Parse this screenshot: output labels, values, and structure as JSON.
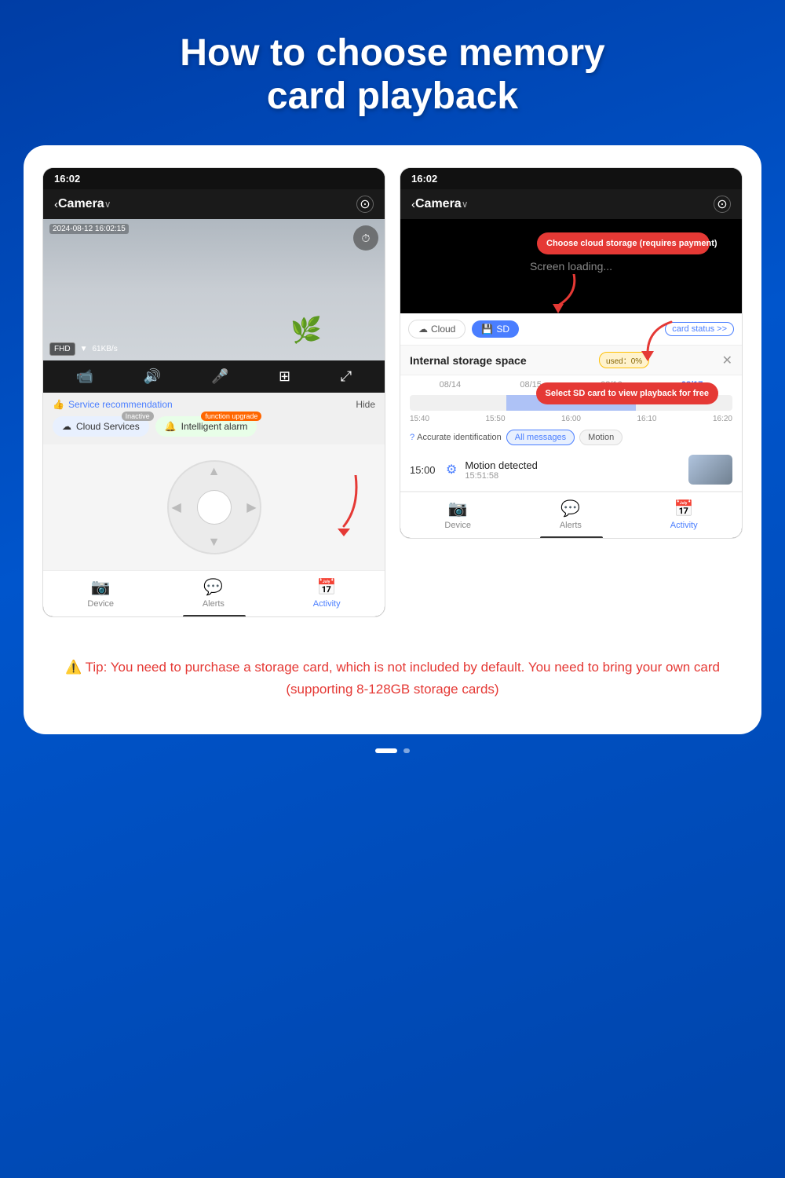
{
  "page": {
    "title_line1": "How to choose memory",
    "title_line2": "card playback",
    "background_color": "#0044bb"
  },
  "left_phone": {
    "status_bar": "16:02",
    "nav_title": "Camera",
    "timestamp": "2024-08-12 16:02:15",
    "quality": "FHD",
    "speed": "61KB/s",
    "rec_label": "Service recommendation",
    "hide_label": "Hide",
    "cloud_btn": "Cloud Services",
    "cloud_badge": "Inactive",
    "alarm_btn": "Intelligent alarm",
    "alarm_badge": "function upgrade",
    "nav_items": [
      {
        "label": "Device",
        "active": false
      },
      {
        "label": "Alerts",
        "active": false
      },
      {
        "label": "Activity",
        "active": true
      }
    ],
    "arrow_hint": "↓"
  },
  "right_phone": {
    "status_bar": "16:02",
    "nav_title": "Camera",
    "loading_text": "Screen loading...",
    "cloud_annotation": "Choose cloud storage (requires payment)",
    "sd_annotation": "Select SD card to view playback for free",
    "tab_cloud": "Cloud",
    "tab_sd": "SD",
    "card_status": "card status >>",
    "storage_title": "Internal storage space",
    "used_label": "used：0%",
    "dates": [
      "08/14",
      "08/15",
      "08/16",
      "08/17"
    ],
    "timeline_labels": [
      "15:40",
      "15:50",
      "16:00",
      "16:10",
      "16:20"
    ],
    "ai_label": "Accurate identification",
    "filter_all": "All messages",
    "filter_motion": "Motion",
    "event_time": "15:00",
    "event_title": "Motion detected",
    "event_subtitle": "15:51:58",
    "nav_items": [
      {
        "label": "Device",
        "active": false
      },
      {
        "label": "Alerts",
        "active": false
      },
      {
        "label": "Activity",
        "active": true
      }
    ]
  },
  "tip": {
    "icon": "⚠️",
    "text": "Tip: You need to purchase a storage card, which is not included by default. You need to bring your own card (supporting 8-128GB storage cards)"
  },
  "page_dots": [
    "active",
    "small"
  ]
}
